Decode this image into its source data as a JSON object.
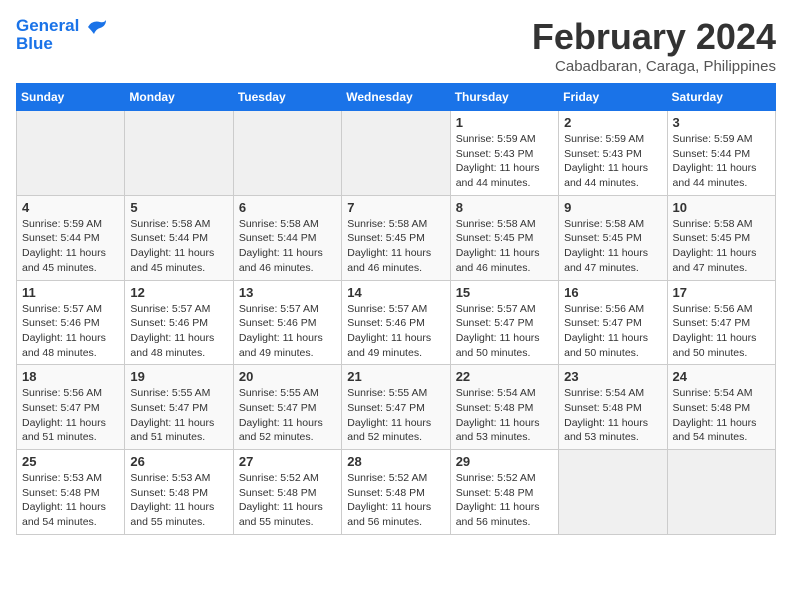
{
  "header": {
    "logo_line1": "General",
    "logo_line2": "Blue",
    "month": "February 2024",
    "location": "Cabadbaran, Caraga, Philippines"
  },
  "weekdays": [
    "Sunday",
    "Monday",
    "Tuesday",
    "Wednesday",
    "Thursday",
    "Friday",
    "Saturday"
  ],
  "weeks": [
    [
      {
        "day": "",
        "info": ""
      },
      {
        "day": "",
        "info": ""
      },
      {
        "day": "",
        "info": ""
      },
      {
        "day": "",
        "info": ""
      },
      {
        "day": "1",
        "info": "Sunrise: 5:59 AM\nSunset: 5:43 PM\nDaylight: 11 hours\nand 44 minutes."
      },
      {
        "day": "2",
        "info": "Sunrise: 5:59 AM\nSunset: 5:43 PM\nDaylight: 11 hours\nand 44 minutes."
      },
      {
        "day": "3",
        "info": "Sunrise: 5:59 AM\nSunset: 5:44 PM\nDaylight: 11 hours\nand 44 minutes."
      }
    ],
    [
      {
        "day": "4",
        "info": "Sunrise: 5:59 AM\nSunset: 5:44 PM\nDaylight: 11 hours\nand 45 minutes."
      },
      {
        "day": "5",
        "info": "Sunrise: 5:58 AM\nSunset: 5:44 PM\nDaylight: 11 hours\nand 45 minutes."
      },
      {
        "day": "6",
        "info": "Sunrise: 5:58 AM\nSunset: 5:44 PM\nDaylight: 11 hours\nand 46 minutes."
      },
      {
        "day": "7",
        "info": "Sunrise: 5:58 AM\nSunset: 5:45 PM\nDaylight: 11 hours\nand 46 minutes."
      },
      {
        "day": "8",
        "info": "Sunrise: 5:58 AM\nSunset: 5:45 PM\nDaylight: 11 hours\nand 46 minutes."
      },
      {
        "day": "9",
        "info": "Sunrise: 5:58 AM\nSunset: 5:45 PM\nDaylight: 11 hours\nand 47 minutes."
      },
      {
        "day": "10",
        "info": "Sunrise: 5:58 AM\nSunset: 5:45 PM\nDaylight: 11 hours\nand 47 minutes."
      }
    ],
    [
      {
        "day": "11",
        "info": "Sunrise: 5:57 AM\nSunset: 5:46 PM\nDaylight: 11 hours\nand 48 minutes."
      },
      {
        "day": "12",
        "info": "Sunrise: 5:57 AM\nSunset: 5:46 PM\nDaylight: 11 hours\nand 48 minutes."
      },
      {
        "day": "13",
        "info": "Sunrise: 5:57 AM\nSunset: 5:46 PM\nDaylight: 11 hours\nand 49 minutes."
      },
      {
        "day": "14",
        "info": "Sunrise: 5:57 AM\nSunset: 5:46 PM\nDaylight: 11 hours\nand 49 minutes."
      },
      {
        "day": "15",
        "info": "Sunrise: 5:57 AM\nSunset: 5:47 PM\nDaylight: 11 hours\nand 50 minutes."
      },
      {
        "day": "16",
        "info": "Sunrise: 5:56 AM\nSunset: 5:47 PM\nDaylight: 11 hours\nand 50 minutes."
      },
      {
        "day": "17",
        "info": "Sunrise: 5:56 AM\nSunset: 5:47 PM\nDaylight: 11 hours\nand 50 minutes."
      }
    ],
    [
      {
        "day": "18",
        "info": "Sunrise: 5:56 AM\nSunset: 5:47 PM\nDaylight: 11 hours\nand 51 minutes."
      },
      {
        "day": "19",
        "info": "Sunrise: 5:55 AM\nSunset: 5:47 PM\nDaylight: 11 hours\nand 51 minutes."
      },
      {
        "day": "20",
        "info": "Sunrise: 5:55 AM\nSunset: 5:47 PM\nDaylight: 11 hours\nand 52 minutes."
      },
      {
        "day": "21",
        "info": "Sunrise: 5:55 AM\nSunset: 5:47 PM\nDaylight: 11 hours\nand 52 minutes."
      },
      {
        "day": "22",
        "info": "Sunrise: 5:54 AM\nSunset: 5:48 PM\nDaylight: 11 hours\nand 53 minutes."
      },
      {
        "day": "23",
        "info": "Sunrise: 5:54 AM\nSunset: 5:48 PM\nDaylight: 11 hours\nand 53 minutes."
      },
      {
        "day": "24",
        "info": "Sunrise: 5:54 AM\nSunset: 5:48 PM\nDaylight: 11 hours\nand 54 minutes."
      }
    ],
    [
      {
        "day": "25",
        "info": "Sunrise: 5:53 AM\nSunset: 5:48 PM\nDaylight: 11 hours\nand 54 minutes."
      },
      {
        "day": "26",
        "info": "Sunrise: 5:53 AM\nSunset: 5:48 PM\nDaylight: 11 hours\nand 55 minutes."
      },
      {
        "day": "27",
        "info": "Sunrise: 5:52 AM\nSunset: 5:48 PM\nDaylight: 11 hours\nand 55 minutes."
      },
      {
        "day": "28",
        "info": "Sunrise: 5:52 AM\nSunset: 5:48 PM\nDaylight: 11 hours\nand 56 minutes."
      },
      {
        "day": "29",
        "info": "Sunrise: 5:52 AM\nSunset: 5:48 PM\nDaylight: 11 hours\nand 56 minutes."
      },
      {
        "day": "",
        "info": ""
      },
      {
        "day": "",
        "info": ""
      }
    ]
  ]
}
